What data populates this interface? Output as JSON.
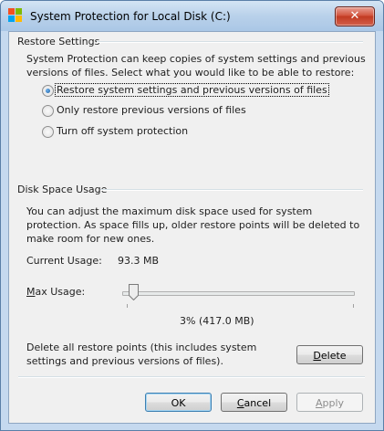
{
  "window": {
    "title": "System Protection for Local Disk (C:)",
    "close_symbol": "✕"
  },
  "restore_settings": {
    "heading": "Restore Settings",
    "description": "System Protection can keep copies of system settings and previous versions of files. Select what you would like to be able to restore:",
    "options": [
      {
        "label": "Restore system settings and previous versions of files",
        "selected": true
      },
      {
        "label": "Only restore previous versions of files",
        "selected": false
      },
      {
        "label": "Turn off system protection",
        "selected": false
      }
    ]
  },
  "disk_space": {
    "heading": "Disk Space Usage",
    "description": "You can adjust the maximum disk space used for system protection. As space fills up, older restore points will be deleted to make room for new ones.",
    "current_usage_label": "Current Usage:",
    "current_usage_value": "93.3 MB",
    "max_usage_label_accel": "M",
    "max_usage_label_rest": "ax Usage:",
    "max_usage_percent": 3,
    "max_usage_text": "3% (417.0 MB)",
    "delete_description": "Delete all restore points (this includes system settings and previous versions of files).",
    "delete_button_accel": "D",
    "delete_button_rest": "elete"
  },
  "buttons": {
    "ok": "OK",
    "cancel_accel": "C",
    "cancel_rest": "ancel",
    "apply_accel": "A",
    "apply_rest": "pply"
  },
  "colors": {
    "titlebar": "#b9d1ea",
    "close_button": "#c23a22",
    "dialog_background": "#f0f0f0"
  }
}
